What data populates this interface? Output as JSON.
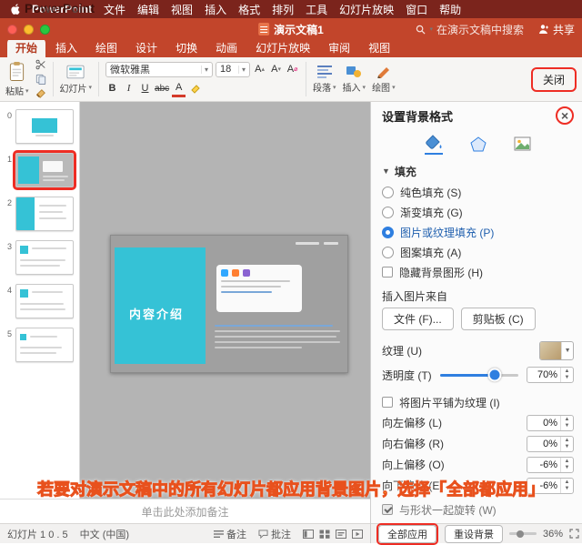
{
  "menu_bar": {
    "items": [
      "PowerPoint",
      "文件",
      "编辑",
      "视图",
      "插入",
      "格式",
      "排列",
      "工具",
      "幻灯片放映",
      "窗口",
      "帮助"
    ]
  },
  "title_bar": {
    "document_title": "演示文稿1",
    "search_placeholder": "在演示文稿中搜索",
    "share_label": "共享"
  },
  "ribbon": {
    "tabs": [
      {
        "label": "开始"
      },
      {
        "label": "插入"
      },
      {
        "label": "绘图"
      },
      {
        "label": "设计"
      },
      {
        "label": "切换"
      },
      {
        "label": "动画"
      },
      {
        "label": "幻灯片放映"
      },
      {
        "label": "审阅"
      },
      {
        "label": "视图"
      }
    ],
    "paste_label": "粘贴",
    "slides_label": "幻灯片",
    "font_name": "微软雅黑",
    "font_size": "18",
    "grow_font_label": "A",
    "shrink_font_label": "A",
    "clear_format_label": "A",
    "bold_label": "B",
    "italic_label": "I",
    "underline_label": "U",
    "strikethrough_label": "abc",
    "font_color_label": "A",
    "paragraph_label": "段落",
    "insert_label": "插入",
    "draw_label": "绘图",
    "close_label": "关闭"
  },
  "slide_panel": {
    "slide_numbers": [
      "0",
      "1",
      "2",
      "3",
      "4",
      "5"
    ],
    "selected_index": 1
  },
  "slide": {
    "title": "内容介绍"
  },
  "format_pane": {
    "title": "设置背景格式",
    "fill_section_label": "填充",
    "fill_options": [
      {
        "label": "纯色填充 (S)",
        "selected": false
      },
      {
        "label": "渐变填充 (G)",
        "selected": false
      },
      {
        "label": "图片或纹理填充 (P)",
        "selected": true
      },
      {
        "label": "图案填充 (A)",
        "selected": false
      }
    ],
    "hide_background_label": "隐藏背景图形 (H)",
    "insert_from_label": "插入图片来自",
    "file_button": "文件 (F)...",
    "clipboard_button": "剪贴板 (C)",
    "texture_label": "纹理 (U)",
    "transparency_label": "透明度 (T)",
    "transparency_value": "70%",
    "tile_label": "将图片平铺为纹理 (I)",
    "offsets": [
      {
        "label": "向左偏移 (L)",
        "value": "0%"
      },
      {
        "label": "向右偏移 (R)",
        "value": "0%"
      },
      {
        "label": "向上偏移 (O)",
        "value": "-6%"
      },
      {
        "label": "向下偏移 (E)",
        "value": "-6%"
      }
    ],
    "rotate_with_shape_label": "与形状一起旋转 (W)",
    "apply_all_button": "全部应用",
    "reset_button": "重设背景"
  },
  "annotation": {
    "tip_text": "若要对演示文稿中的所有幻灯片都应用背景图片，选择「全部都应用」",
    "watermark": "PowerPoint"
  },
  "notes": {
    "placeholder": "单击此处添加备注"
  },
  "status_bar": {
    "slide_info": "幻灯片 1 0 . 5",
    "language": "中文 (中国)",
    "notes_label": "备注",
    "comments_label": "批注",
    "zoom_value": "36%"
  }
}
